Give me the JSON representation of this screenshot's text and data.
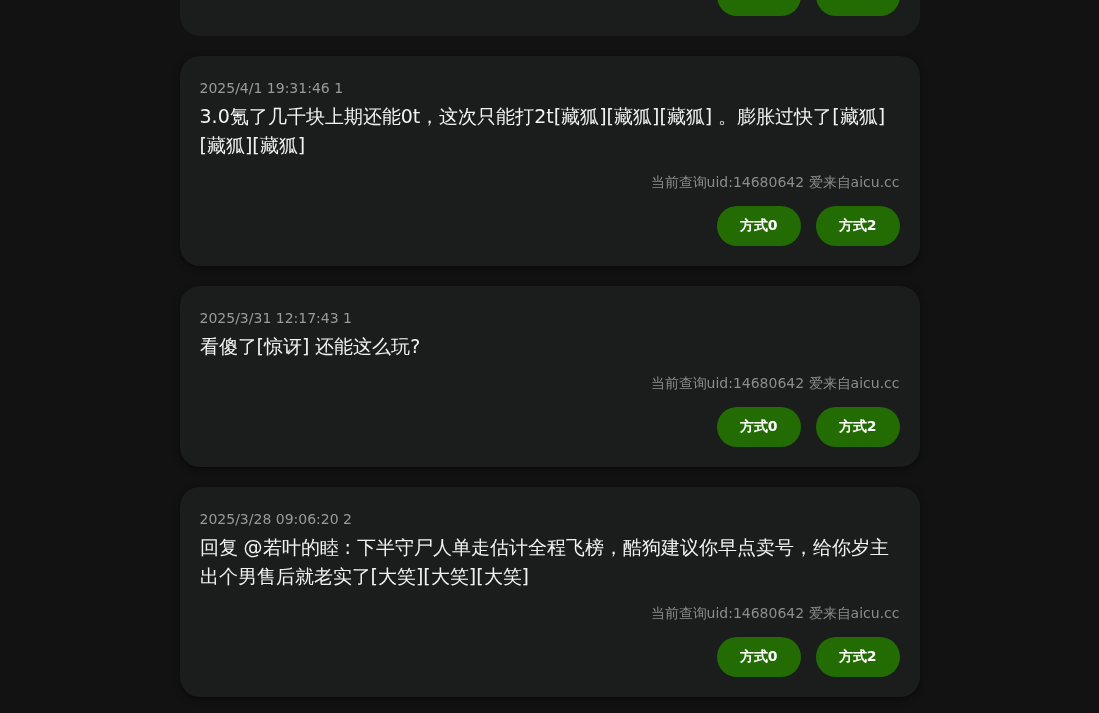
{
  "partial_card": {
    "buttons": [
      {
        "kind": "method"
      },
      {
        "kind": "method"
      }
    ]
  },
  "comments": [
    {
      "meta": "2025/4/1 19:31:46 1",
      "text": "3.0氪了几千块上期还能0t，这次只能打2t[藏狐][藏狐][藏狐] 。膨胀过快了[藏狐][藏狐][藏狐]",
      "source": "当前查询uid:14680642 爱来自aicu.cc",
      "buttons": [
        "方式0",
        "方式2"
      ]
    },
    {
      "meta": "2025/3/31 12:17:43 1",
      "text": "看傻了[惊讶] 还能这么玩?",
      "source": "当前查询uid:14680642 爱来自aicu.cc",
      "buttons": [
        "方式0",
        "方式2"
      ]
    },
    {
      "meta": "2025/3/28 09:06:20 2",
      "text": "回复 @若叶的睦 : 下半守尸人单走估计全程飞榜，酷狗建议你早点卖号，给你岁主出个男售后就老实了[大笑][大笑][大笑]",
      "source": "当前查询uid:14680642 爱来自aicu.cc",
      "buttons": [
        "方式0",
        "方式2"
      ]
    }
  ]
}
